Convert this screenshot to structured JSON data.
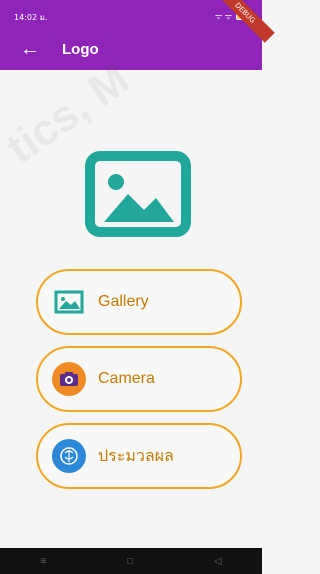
{
  "status_bar": {
    "time": "14:02 ม.",
    "signal_text": "ᯤ ᯤ"
  },
  "app_bar": {
    "back_icon": "arrow-left-icon",
    "title": "Logo"
  },
  "debug_banner": "DEBUG",
  "hero_icon": "image-icon",
  "buttons": [
    {
      "label": "Gallery",
      "icon": "gallery-icon"
    },
    {
      "label": "Camera",
      "icon": "camera-icon"
    },
    {
      "label": "ประมวลผล",
      "icon": "process-icon"
    }
  ],
  "colors": {
    "primary": "#8e25b8",
    "accent": "#f2a623",
    "teal": "#22a89a",
    "label": "#c37b00"
  },
  "nav_bar": {
    "menu": "≡",
    "home": "□",
    "back": "◁"
  }
}
